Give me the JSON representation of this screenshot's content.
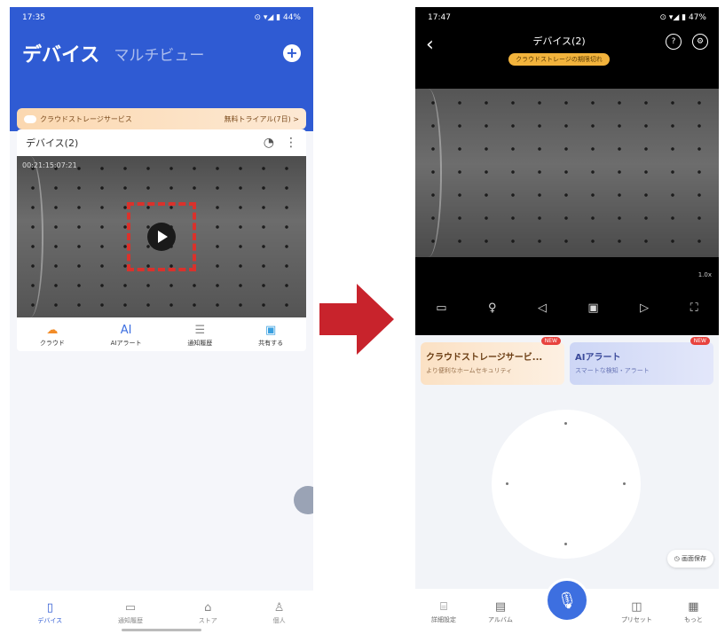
{
  "left": {
    "status": {
      "time": "17:35",
      "right": "⊙ ▾◢ ▮ 44%"
    },
    "header": {
      "title": "デバイス",
      "subtitle": "マルチビュー"
    },
    "banner": {
      "left": "クラウドストレージサービス",
      "right": "無料トライアル(7日) >"
    },
    "card": {
      "name": "デバイス(2)",
      "timestamp": "00:21:15:07:21"
    },
    "features": [
      {
        "icon": "cloud-icon",
        "label": "クラウド"
      },
      {
        "icon": "ai-icon",
        "label": "AIアラート"
      },
      {
        "icon": "history-icon",
        "label": "通知履歴"
      },
      {
        "icon": "share-icon",
        "label": "共有する"
      }
    ],
    "tabs": [
      {
        "icon": "device-icon",
        "label": "デバイス"
      },
      {
        "icon": "message-icon",
        "label": "通知履歴"
      },
      {
        "icon": "store-icon",
        "label": "ストア"
      },
      {
        "icon": "profile-icon",
        "label": "個人"
      }
    ]
  },
  "right": {
    "status": {
      "time": "17:47",
      "right": "⊙ ▾◢ ▮ 47%"
    },
    "header": {
      "device": "デバイス(2)",
      "tag": "クラウドストレージの期限切れ"
    },
    "zoom": "1.0x",
    "controls": [
      "screen",
      "light",
      "sound",
      "snapshot",
      "record",
      "fullscreen"
    ],
    "promos": [
      {
        "title": "クラウドストレージサービ...",
        "sub": "より便利なホームセキュリティ",
        "badge": "NEW"
      },
      {
        "title": "AIアラート",
        "sub": "スマートな検知・アラート",
        "badge": "NEW"
      }
    ],
    "preset_label": "◷ 画面保存",
    "tabs": [
      {
        "icon": "settings-icon",
        "label": "詳細設定"
      },
      {
        "icon": "album-icon",
        "label": "アルバム"
      },
      {
        "icon": "preset-icon",
        "label": "プリセット"
      },
      {
        "icon": "more-icon",
        "label": "もっと"
      }
    ]
  },
  "colors": {
    "brand": "#2f5bd3",
    "arrow": "#c8232c",
    "highlight": "#d9322c",
    "mic": "#3d6fe0"
  }
}
